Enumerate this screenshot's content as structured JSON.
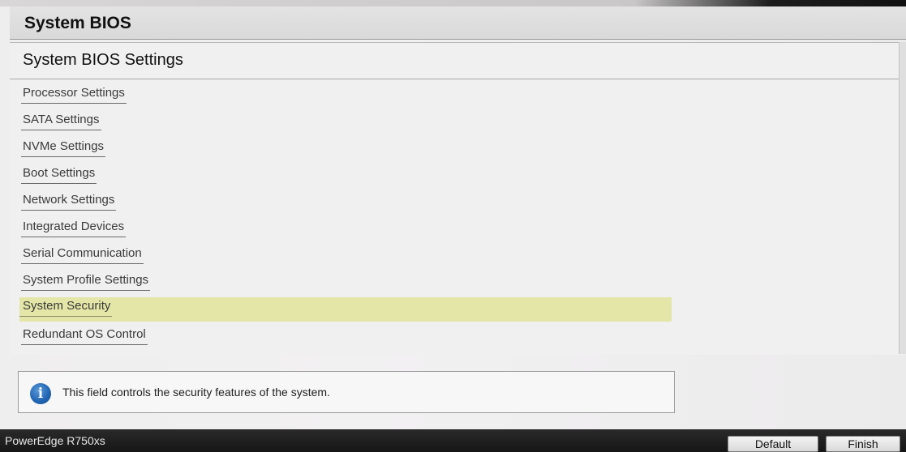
{
  "window": {
    "title": "System BIOS"
  },
  "page": {
    "title": "System BIOS Settings"
  },
  "menu": {
    "items": [
      {
        "label": "Processor Settings"
      },
      {
        "label": "SATA Settings"
      },
      {
        "label": "NVMe Settings"
      },
      {
        "label": "Boot Settings"
      },
      {
        "label": "Network Settings"
      },
      {
        "label": "Integrated Devices"
      },
      {
        "label": "Serial Communication"
      },
      {
        "label": "System Profile Settings"
      },
      {
        "label": "System Security",
        "selected": true
      },
      {
        "label": "Redundant OS Control"
      }
    ]
  },
  "help": {
    "icon": "info-icon",
    "text": "This field controls the security features of the system."
  },
  "footer": {
    "model": "PowerEdge R750xs",
    "default_label": "Default",
    "finish_label": "Finish"
  },
  "colors": {
    "selection_highlight": "#e3e6a6",
    "footer_background": "#1c1c1c",
    "info_icon": "#1f63b2"
  }
}
